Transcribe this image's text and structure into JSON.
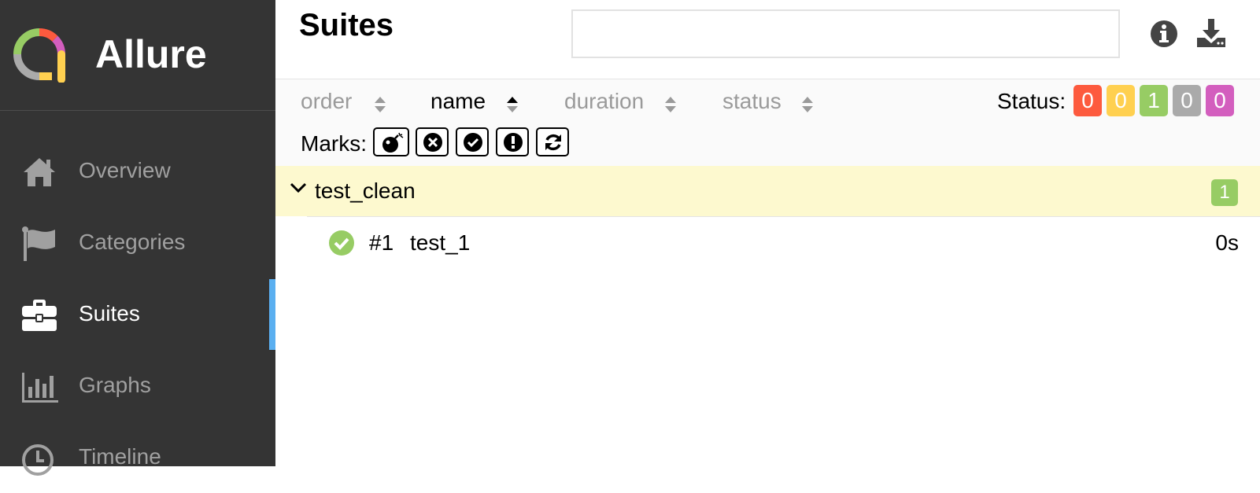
{
  "brand": {
    "name": "Allure"
  },
  "sidebar": {
    "items": [
      {
        "label": "Overview",
        "icon": "home-icon",
        "active": false
      },
      {
        "label": "Categories",
        "icon": "flag-icon",
        "active": false
      },
      {
        "label": "Suites",
        "icon": "briefcase-icon",
        "active": true
      },
      {
        "label": "Graphs",
        "icon": "bar-chart-icon",
        "active": false
      },
      {
        "label": "Timeline",
        "icon": "clock-icon",
        "active": false
      }
    ]
  },
  "header": {
    "title": "Suites",
    "search": {
      "value": "",
      "placeholder": ""
    },
    "buttons": [
      {
        "icon": "info-icon"
      },
      {
        "icon": "download-icon"
      }
    ]
  },
  "toolbar": {
    "sorters": [
      {
        "label": "order",
        "active": false
      },
      {
        "label": "name",
        "active": true,
        "direction": "asc"
      },
      {
        "label": "duration",
        "active": false
      },
      {
        "label": "status",
        "active": false
      }
    ],
    "status_label": "Status:",
    "status_filters": [
      {
        "status": "failed",
        "count": "0",
        "color": "#fd5a3e"
      },
      {
        "status": "broken",
        "count": "0",
        "color": "#ffd050"
      },
      {
        "status": "passed",
        "count": "1",
        "color": "#97cc64"
      },
      {
        "status": "skipped",
        "count": "0",
        "color": "#aaaaaa"
      },
      {
        "status": "unknown",
        "count": "0",
        "color": "#d35ebe"
      }
    ],
    "marks_label": "Marks:",
    "marks": [
      "bomb-icon",
      "times-circle-icon",
      "check-circle-icon",
      "exclamation-circle-icon",
      "refresh-icon"
    ]
  },
  "tree": {
    "groups": [
      {
        "name": "test_clean",
        "count": "1",
        "expanded": true,
        "tests": [
          {
            "number": "#1",
            "name": "test_1",
            "duration": "0s",
            "status": "passed"
          }
        ]
      }
    ]
  },
  "colors": {
    "sidebar_bg": "#343434",
    "active_marker": "#5aaff0",
    "group_bg": "#fdf9cf",
    "passed": "#97cc64"
  }
}
